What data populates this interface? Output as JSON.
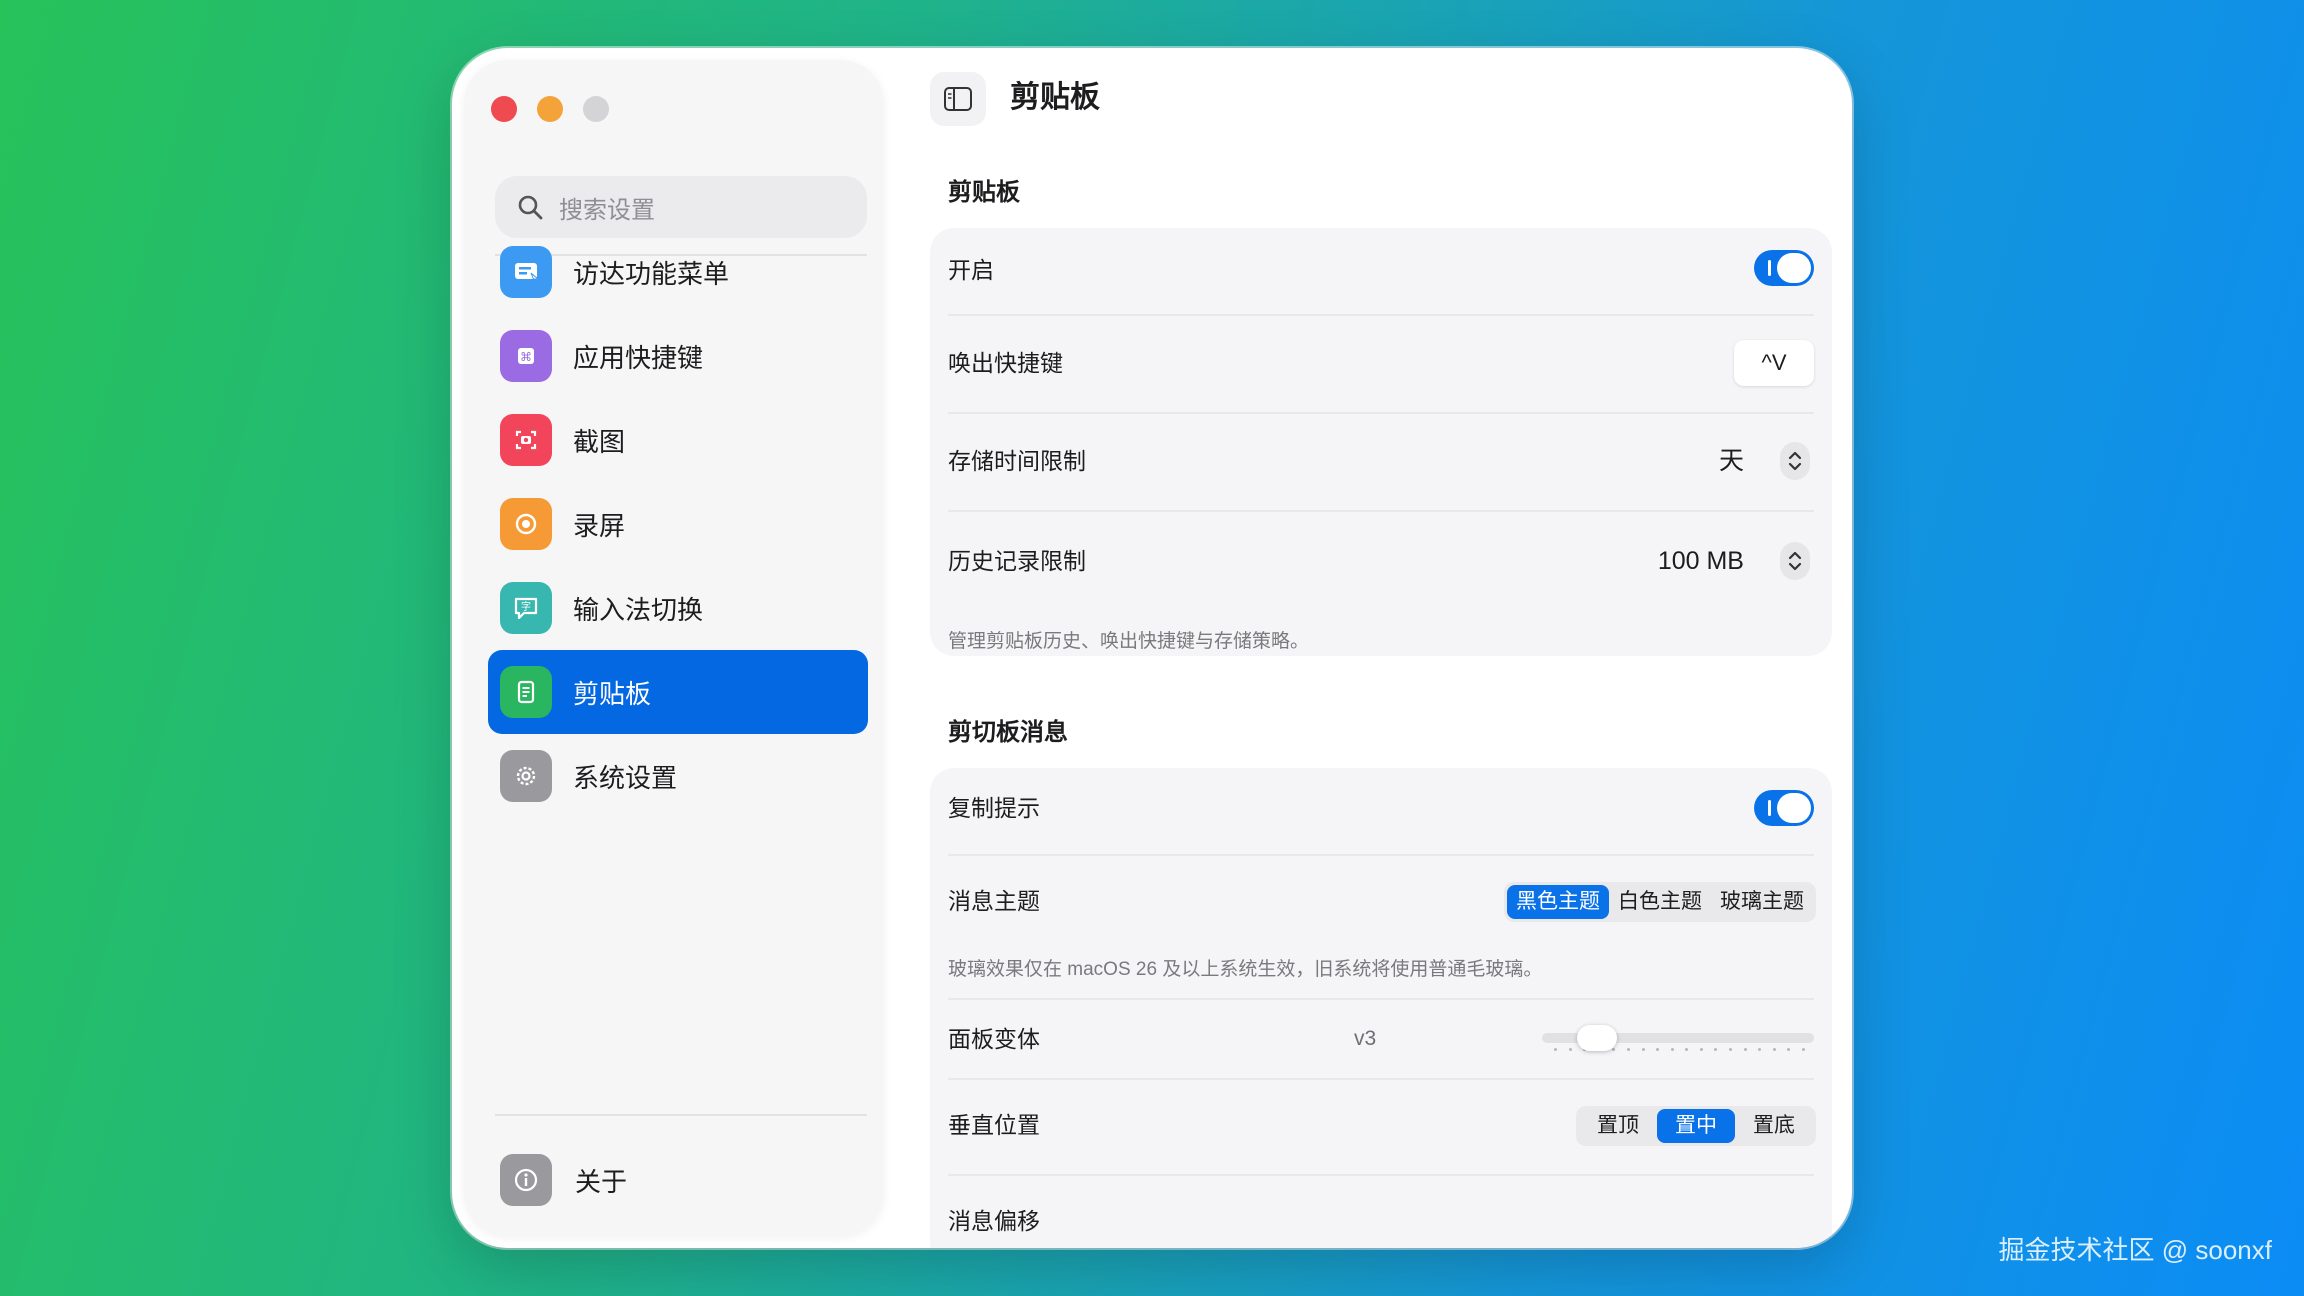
{
  "sidebar": {
    "search_placeholder": "搜索设置",
    "items": [
      {
        "label": "访达功能菜单",
        "icon": "finder-menu-icon",
        "color": "#3d9af2"
      },
      {
        "label": "应用快捷键",
        "icon": "app-shortcut-icon",
        "color": "#9b6be3"
      },
      {
        "label": "截图",
        "icon": "screenshot-icon",
        "color": "#f2445a"
      },
      {
        "label": "录屏",
        "icon": "screen-record-icon",
        "color": "#f59a35"
      },
      {
        "label": "输入法切换",
        "icon": "input-method-icon",
        "color": "#38b7b0"
      },
      {
        "label": "剪贴板",
        "icon": "clipboard-icon",
        "color": "#2ab660",
        "active": true
      },
      {
        "label": "系统设置",
        "icon": "gear-icon",
        "color": "#9a9a9e"
      }
    ],
    "about_label": "关于"
  },
  "header": {
    "title": "剪贴板"
  },
  "clipboard_section": {
    "title": "剪贴板",
    "enable_label": "开启",
    "enable_on": true,
    "hotkey_label": "唤出快捷键",
    "hotkey_value": "^V",
    "storage_label": "存储时间限制",
    "storage_value": "天",
    "history_label": "历史记录限制",
    "history_value": "100 MB",
    "caption": "管理剪贴板历史、唤出快捷键与存储策略。"
  },
  "message_section": {
    "title": "剪切板消息",
    "copy_hint_label": "复制提示",
    "copy_hint_on": true,
    "theme_label": "消息主题",
    "theme_options": [
      "黑色主题",
      "白色主题",
      "玻璃主题"
    ],
    "theme_selected": "黑色主题",
    "glass_note": "玻璃效果仅在 macOS 26 及以上系统生效，旧系统将使用普通毛玻璃。",
    "variant_label": "面板变体",
    "variant_value": "v3",
    "variant_level": 0.15,
    "position_label": "垂直位置",
    "position_options": [
      "置顶",
      "置中",
      "置底"
    ],
    "position_selected": "置中",
    "offset_label": "消息偏移"
  },
  "watermark": "掘金技术社区 @ soonxf",
  "colors": {
    "accent": "#0a72e8",
    "active_nav": "#0568e3"
  }
}
